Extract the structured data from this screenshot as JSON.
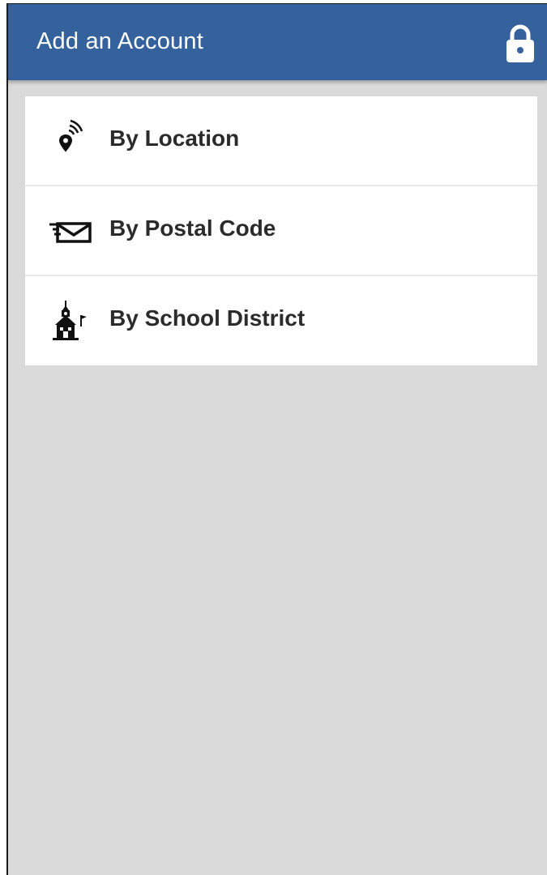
{
  "header": {
    "title": "Add an Account",
    "lock_icon": "lock-icon"
  },
  "options": [
    {
      "label": "By Location",
      "icon": "location-signal-icon"
    },
    {
      "label": "By Postal Code",
      "icon": "envelope-icon"
    },
    {
      "label": "By School District",
      "icon": "schoolhouse-icon"
    }
  ],
  "colors": {
    "appbar": "#35629c",
    "background": "#dadada",
    "card": "#ffffff",
    "text": "#2b2b2b"
  }
}
